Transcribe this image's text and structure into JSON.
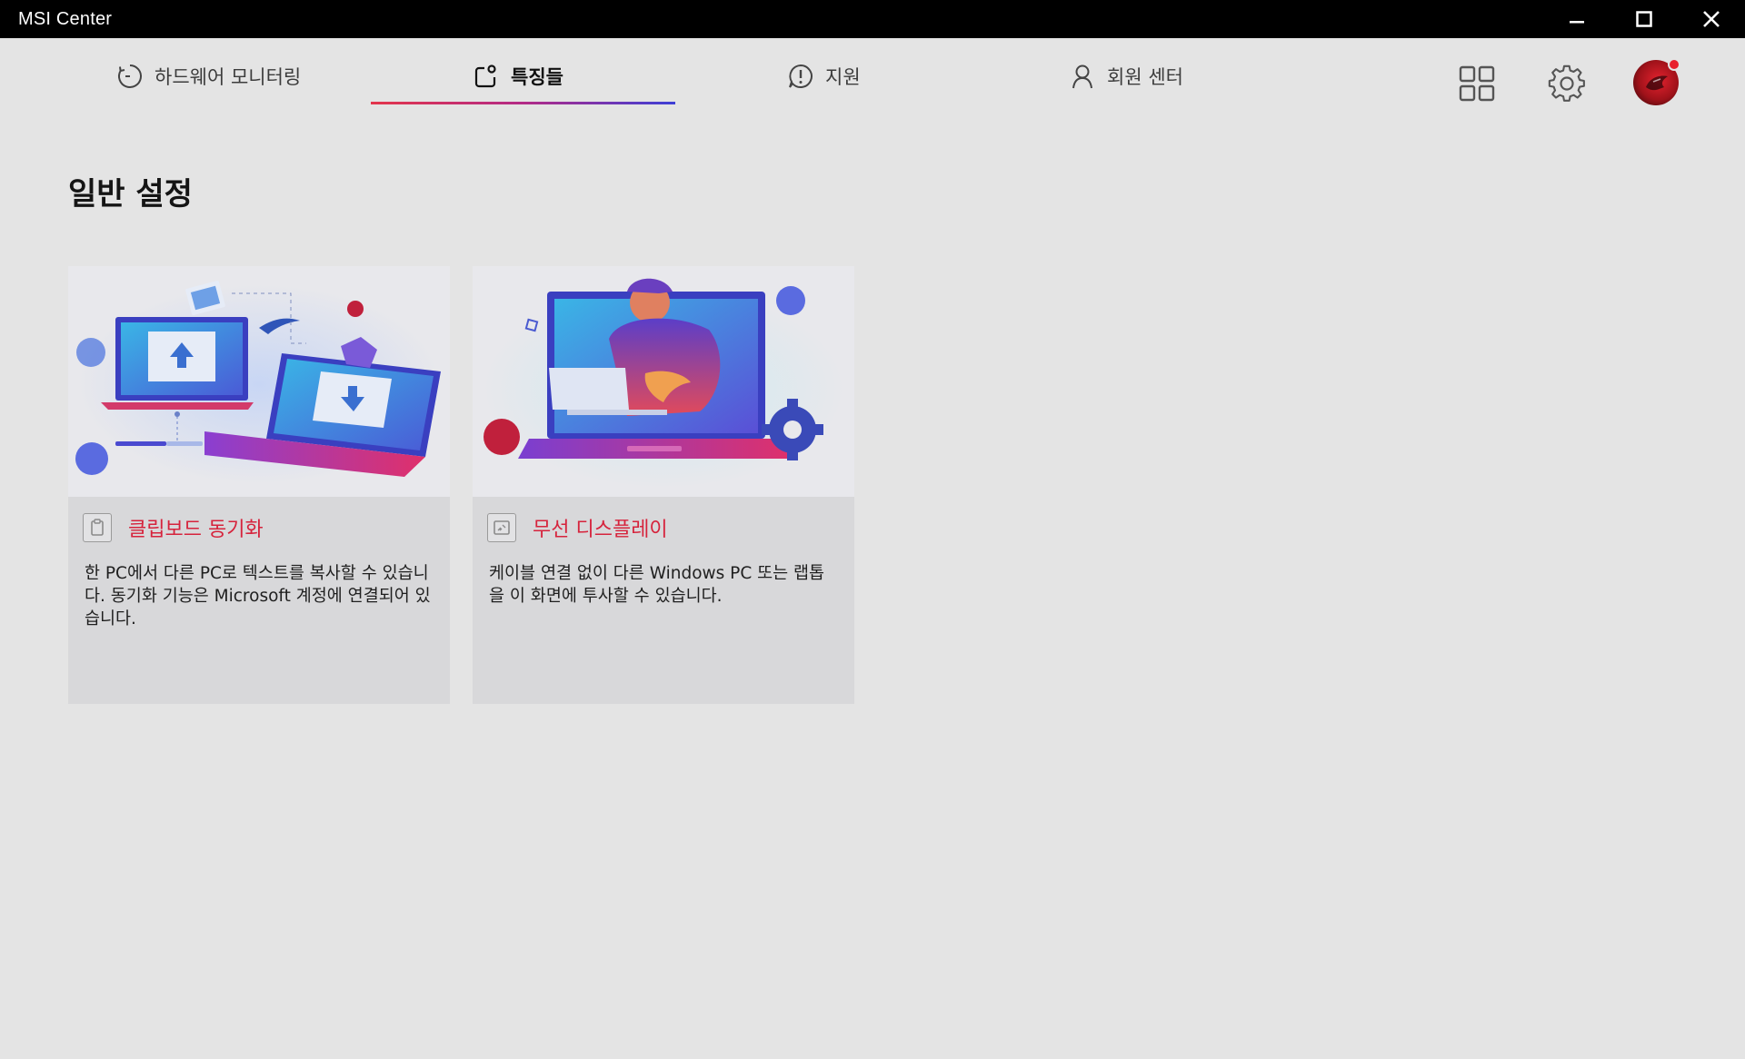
{
  "window": {
    "title": "MSI Center"
  },
  "nav": {
    "tabs": [
      {
        "label": "하드웨어 모니터링",
        "icon": "gauge-icon",
        "active": false
      },
      {
        "label": "특징들",
        "icon": "features-icon",
        "active": true
      },
      {
        "label": "지원",
        "icon": "alert-circle-icon",
        "active": false
      },
      {
        "label": "회원 센터",
        "icon": "user-icon",
        "active": false
      }
    ],
    "right_icons": [
      "grid-icon",
      "gear-icon",
      "avatar"
    ]
  },
  "page": {
    "title": "일반 설정"
  },
  "cards": [
    {
      "title": "클립보드 동기화",
      "description": "한 PC에서 다른 PC로 텍스트를 복사할 수 있습니다. 동기화 기능은 Microsoft 계정에 연결되어 있습니다.",
      "icon": "clipboard-icon"
    },
    {
      "title": "무선 디스플레이",
      "description": "케이블 연결 없이 다른 Windows PC 또는 랩톱을 이 화면에 투사할 수 있습니다.",
      "icon": "wireless-display-icon"
    }
  ],
  "colors": {
    "accent_red": "#d6233c",
    "underline_gradient": [
      "#e3354b",
      "#3d3fd6"
    ],
    "titlebar": "#000000",
    "background": "#e4e4e4"
  }
}
